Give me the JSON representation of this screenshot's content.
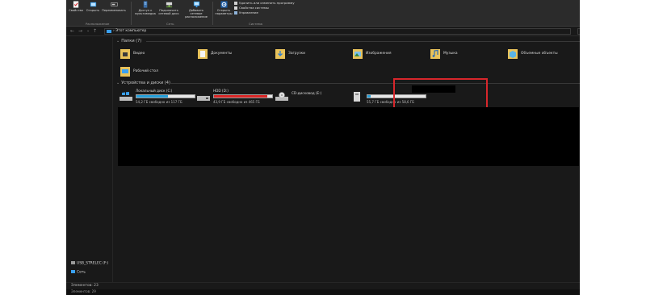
{
  "ribbon": {
    "groups": [
      {
        "label": "Расположение",
        "buttons": [
          "Свойства",
          "Открыть",
          "Переименовать"
        ]
      },
      {
        "label": "Сеть",
        "buttons": [
          "Доступ к мультимедиа",
          "Подключить сетевой диск",
          "Добавить сетевое расположение"
        ]
      },
      {
        "label": "Система",
        "buttons": [
          "Открыть параметры"
        ]
      }
    ],
    "system_links": [
      "Удалить или изменить программу",
      "Свойства системы",
      "Управление"
    ]
  },
  "address": {
    "breadcrumb": "Этот компьютер",
    "search_placeholder": "Поиск: Этот компьютер"
  },
  "nav_pane": {
    "items": [
      {
        "label": "USB_STRELEC (F:)",
        "icon": "usb-drive-icon"
      },
      {
        "label": "Сеть",
        "icon": "network-icon"
      }
    ]
  },
  "folders_section": {
    "title": "Папки (7)",
    "items": [
      {
        "label": "Видео",
        "icon": "video-folder-icon"
      },
      {
        "label": "Документы",
        "icon": "documents-folder-icon"
      },
      {
        "label": "Загрузки",
        "icon": "downloads-folder-icon"
      },
      {
        "label": "Изображения",
        "icon": "pictures-folder-icon"
      },
      {
        "label": "Музыка",
        "icon": "music-folder-icon"
      },
      {
        "label": "Объемные объекты",
        "icon": "3d-objects-folder-icon"
      },
      {
        "label": "Рабочий стол",
        "icon": "desktop-folder-icon"
      }
    ]
  },
  "drives_section": {
    "title": "Устройства и диски (4)",
    "drives": [
      {
        "name": "Локальный диск (C:)",
        "free": "54,2 ГБ свободно из 117 ГБ",
        "used_fraction": 0.54,
        "bar_color": "#26a0da"
      },
      {
        "name": "HDD (D:)",
        "free": "43,9 ГБ свободно из 465 ГБ",
        "used_fraction": 0.91,
        "bar_color": "#da2626"
      },
      {
        "name": "CD-дисковод (E:)",
        "free": "",
        "used_fraction": null,
        "bar_color": ""
      },
      {
        "name": "",
        "free": "55,7 ГБ свободно из 58,6 ГБ",
        "used_fraction": 0.05,
        "bar_color": "#26a0da"
      }
    ]
  },
  "status": {
    "left": "Элементов: 23",
    "taskbar_left": "Элементов: 29",
    "taskbar_right": "Выделено"
  },
  "colors": {
    "highlight": "#d7262b",
    "folder": "#e8c25a",
    "accent": "#26a0da"
  }
}
